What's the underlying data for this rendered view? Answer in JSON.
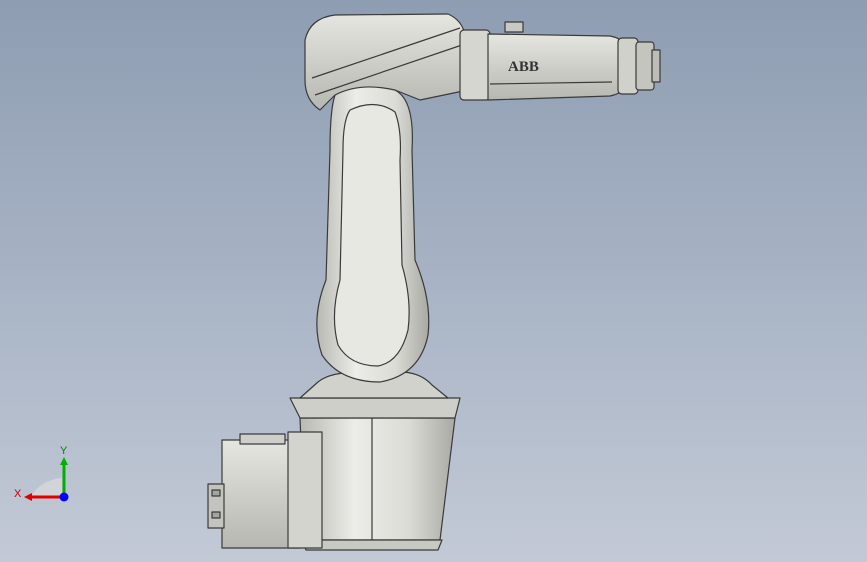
{
  "viewport": {
    "background_top": "#8e9db2",
    "background_bottom": "#c3cad6"
  },
  "model": {
    "brand_logo": "ABB",
    "body_color": "#d9d9d4",
    "edge_color": "#3a3a3a"
  },
  "triad": {
    "x_label": "X",
    "y_label": "Y",
    "x_color": "#e00000",
    "y_color": "#00b000",
    "z_color": "#0000ff"
  }
}
